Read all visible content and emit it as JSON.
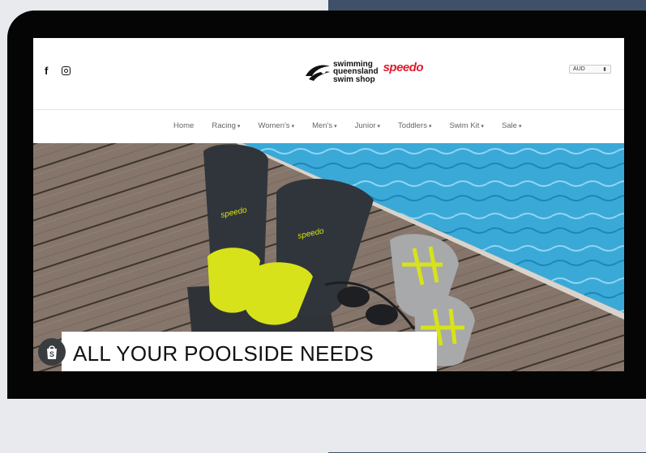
{
  "store": {
    "logo_text_lines": [
      "swimming",
      "queensland",
      "swim shop"
    ],
    "brand": "speedo",
    "currency": "AUD"
  },
  "social": [
    "facebook-icon",
    "instagram-icon"
  ],
  "nav": [
    {
      "label": "Home",
      "dropdown": false
    },
    {
      "label": "Racing",
      "dropdown": true
    },
    {
      "label": "Women's",
      "dropdown": true
    },
    {
      "label": "Men's",
      "dropdown": true
    },
    {
      "label": "Junior",
      "dropdown": true
    },
    {
      "label": "Toddlers",
      "dropdown": true
    },
    {
      "label": "Swim Kit",
      "dropdown": true
    },
    {
      "label": "Sale",
      "dropdown": true
    }
  ],
  "hero": {
    "headline": "ALL YOUR POOLSIDE NEEDS",
    "fin_brand": "speedo",
    "board_text": "spee"
  },
  "colors": {
    "brand_red": "#e21a2c",
    "pool_blue": "#3aa9d8",
    "fin_yellow": "#d7e21a",
    "deck_wood": "#8b7b6b"
  }
}
